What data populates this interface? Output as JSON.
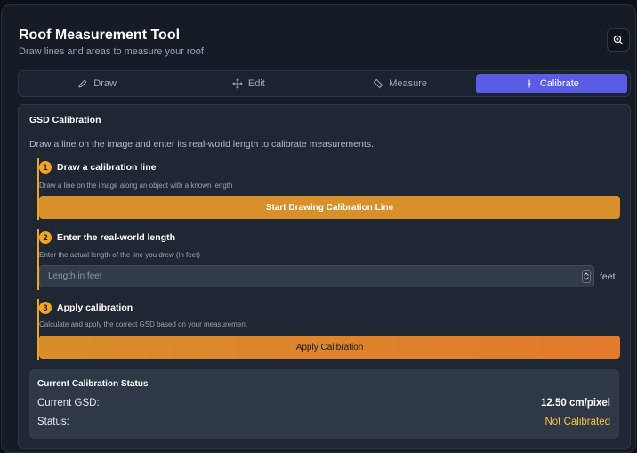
{
  "header": {
    "title": "Roof Measurement Tool",
    "subtitle": "Draw lines and areas to measure your roof"
  },
  "tabs": [
    {
      "label": "Draw",
      "icon": "pencil-icon",
      "active": false
    },
    {
      "label": "Edit",
      "icon": "move-icon",
      "active": false
    },
    {
      "label": "Measure",
      "icon": "ruler-icon",
      "active": false
    },
    {
      "label": "Calibrate",
      "icon": "crosshair-icon",
      "active": true
    }
  ],
  "calibration": {
    "title": "GSD Calibration",
    "description": "Draw a line on the image and enter its real-world length to calibrate measurements.",
    "steps": [
      {
        "number": "1",
        "title": "Draw a calibration line",
        "description": "Draw a line on the image along an object with a known length",
        "button": "Start Drawing Calibration Line"
      },
      {
        "number": "2",
        "title": "Enter the real-world length",
        "description": "Enter the actual length of the line you drew (in feet)",
        "input_placeholder": "Length in feet",
        "input_value": "",
        "unit": "feet"
      },
      {
        "number": "3",
        "title": "Apply calibration",
        "description": "Calculate and apply the correct GSD based on your measurement",
        "button": "Apply Calibration"
      }
    ]
  },
  "status": {
    "title": "Current Calibration Status",
    "gsd_label": "Current GSD:",
    "gsd_value": "12.50 cm/pixel",
    "status_label": "Status:",
    "status_value": "Not Calibrated"
  },
  "colors": {
    "accent": "#5b5ce6",
    "step_orange": "#f0a32a",
    "warning": "#f5c542"
  }
}
